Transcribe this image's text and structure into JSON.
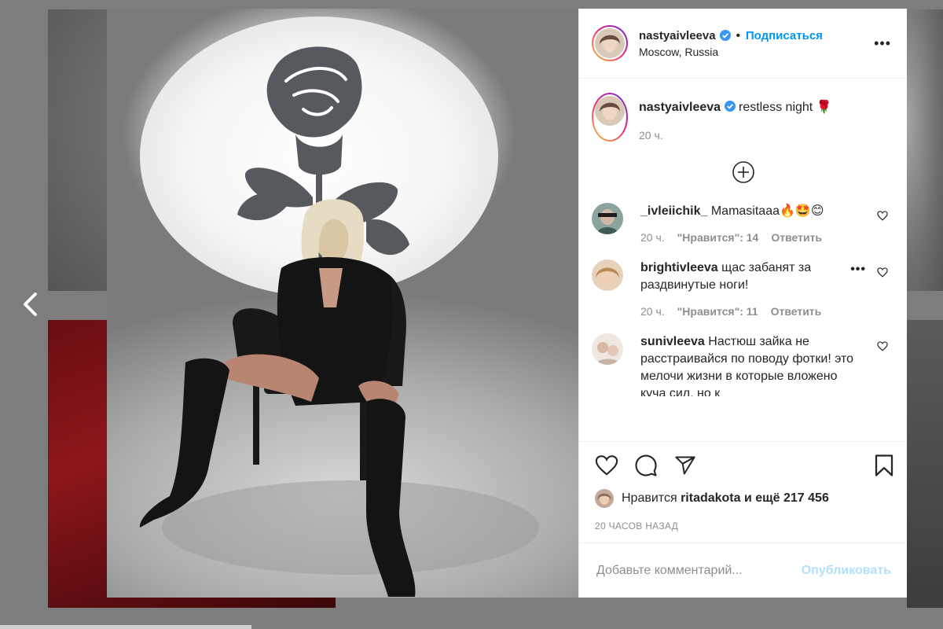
{
  "post": {
    "username": "nastyaivleeva",
    "follow_label": "Подписаться",
    "dot": "•",
    "location": "Moscow, Russia",
    "more_label": "•••",
    "caption": "restless night 🌹",
    "caption_time": "20 ч.",
    "verified": true,
    "photo_subject": "woman in black boots on chair under rose-shaped spotlight"
  },
  "comments": [
    {
      "username": "_ivleiichik_",
      "text": "Mamasitaaa🔥🤩😊",
      "time": "20 ч.",
      "likes_label": "\"Нравится\": 14",
      "reply_label": "Ответить",
      "show_more": false
    },
    {
      "username": "brightivleeva",
      "text": "щас забанят за раздвинутые ноги!",
      "time": "20 ч.",
      "likes_label": "\"Нравится\": 11",
      "reply_label": "Ответить",
      "show_more": true,
      "more_label": "•••"
    },
    {
      "username": "sunivleeva",
      "text": "Настюш зайка не расстраивайся по поводу фотки! это мелочи жизни в которые вложено куча сил, но к",
      "show_more": false
    }
  ],
  "actions": {
    "liked_by_prefix": "Нравится",
    "liked_by_user": "ritadakota",
    "liked_by_suffix": "и ещё 217 456",
    "timestamp": "20 ЧАСОВ НАЗАД"
  },
  "composer": {
    "placeholder": "Добавьте комментарий...",
    "post_label": "Опубликовать"
  },
  "colors": {
    "follow_blue": "#0095f6",
    "post_disabled": "#b2dffc",
    "muted": "#8e8e8e",
    "verified_blue": "#3897f0"
  },
  "icons": {
    "prev": "chevron-left-icon",
    "load_more": "plus-circle-icon",
    "like": "heart-icon",
    "comment": "comment-bubble-icon",
    "share": "paper-plane-icon",
    "save": "bookmark-icon"
  }
}
